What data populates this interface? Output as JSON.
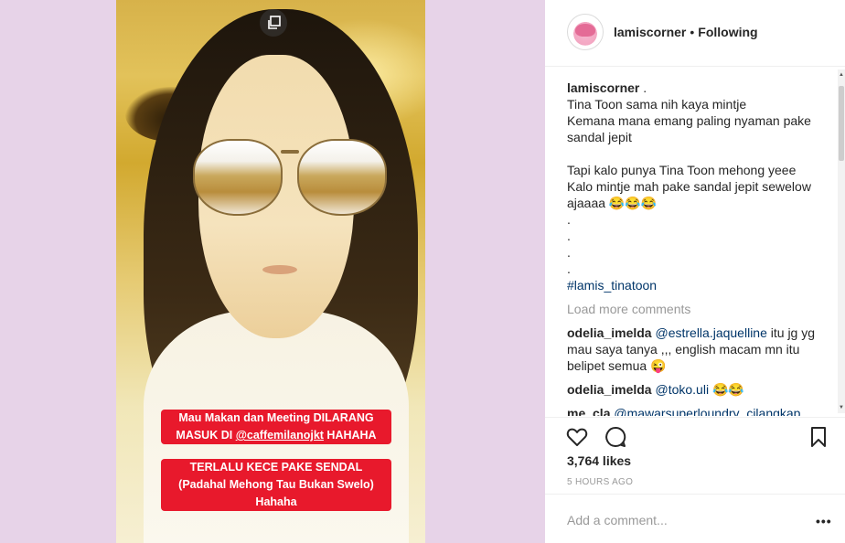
{
  "post": {
    "media": {
      "icon": "multiple-posts-icon",
      "caption_line1": "Mau Makan dan Meeting DILARANG",
      "caption_line2_prefix": "MASUK DI ",
      "caption_line2_mention": "@caffemilanojkt",
      "caption_line2_suffix": " HAHAHA",
      "caption_line3": "TERLALU KECE PAKE SENDAL",
      "caption_line4": "(Padahal Mehong Tau Bukan Swelo)",
      "caption_line5": "Hahaha"
    },
    "header": {
      "username": "lamiscorner",
      "separator": "•",
      "follow_status": "Following"
    },
    "caption": {
      "username": "lamiscorner",
      "suffix": " .",
      "lines": [
        "Tina Toon sama nih kaya mintje",
        "Kemana mana emang paling nyaman pake",
        "sandal jepit",
        "",
        "Tapi kalo punya Tina Toon mehong yeee",
        "Kalo mintje mah pake sandal jepit sewelow",
        "ajaaaa 😂😂😂",
        ".",
        ".",
        ".",
        "."
      ],
      "hashtag": "#lamis_tinatoon"
    },
    "load_more": "Load more comments",
    "comments": [
      {
        "user": "odelia_imelda",
        "mention": "@estrella.jaquelline",
        "text_line1": " itu jg yg",
        "text_line2": "mau saya tanya ,,, english macam mn itu",
        "text_line3": "belipet semua 😜"
      },
      {
        "user": "odelia_imelda",
        "mention": "@toko.uli",
        "text_line1": " 😂😂",
        "text_line2": "",
        "text_line3": ""
      },
      {
        "user": "me_cla",
        "mention": "@mawarsuperloundry_cilangkap",
        "text_line1": "",
        "text_line2": "",
        "text_line3": ""
      }
    ],
    "likes": "3,764 likes",
    "timestamp": "5 HOURS AGO",
    "comment_placeholder": "Add a comment...",
    "more_icon": "more-options-icon",
    "more_text": "•••"
  },
  "colors": {
    "background": "#e7d3e8",
    "caption_red": "#e8192c",
    "link_blue": "#003569",
    "muted": "#999999"
  }
}
